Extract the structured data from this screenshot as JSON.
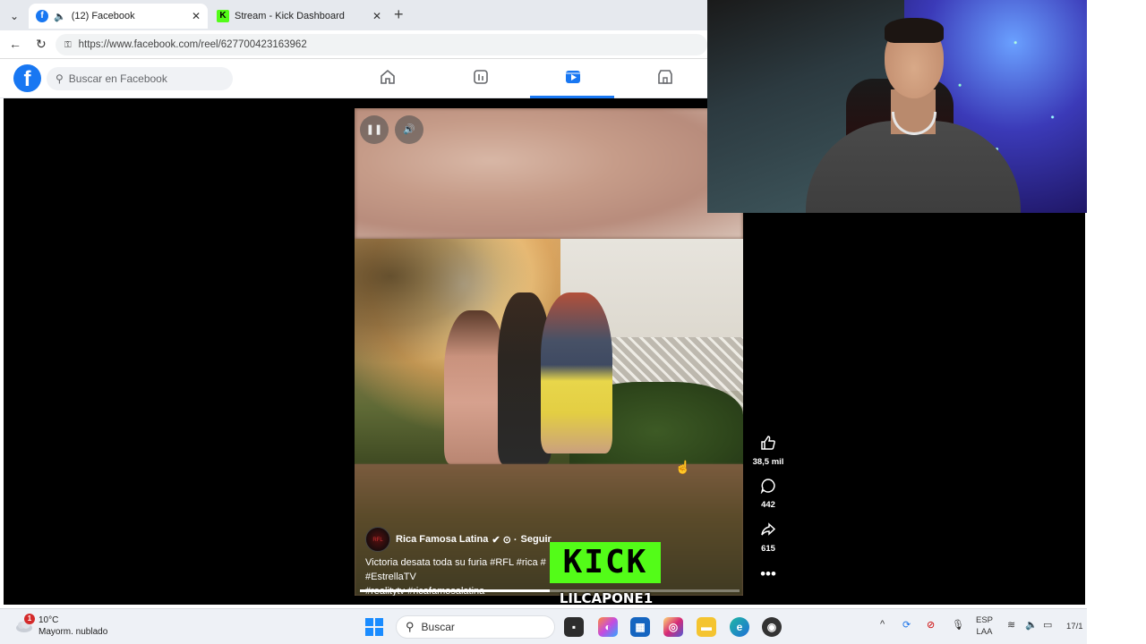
{
  "browser": {
    "tabs": [
      {
        "label": "(12) Facebook",
        "active": true
      },
      {
        "label": "Stream - Kick Dashboard",
        "active": false
      }
    ],
    "url": "https://www.facebook.com/reel/627700423163962"
  },
  "facebook": {
    "search_placeholder": "Buscar en Facebook",
    "logo_letter": "f"
  },
  "reel": {
    "author": "Rica Famosa Latina",
    "author_marks": "✔ ⊙ ·",
    "follow_label": "Seguir",
    "caption_line1": "Victoria desata toda su furia #RFL #rica #",
    "caption_line1_end": "#EstrellaTV",
    "caption_line2": "#realitytv #ricafamosalatina",
    "progress": 0.5,
    "likes": "38,5 mil",
    "comments": "442",
    "shares": "615"
  },
  "overlay": {
    "kick_logo": "KICK",
    "kick_user": "LILCAPONE1"
  },
  "taskbar": {
    "weather_badge": "1",
    "temperature": "10°C",
    "weather_desc": "Mayorm. nublado",
    "search_label": "Buscar",
    "lang_line1": "ESP",
    "lang_line2": "LAA",
    "clock": "17/1"
  },
  "colors": {
    "facebook_blue": "#1877f2",
    "kick_green": "#53fc18"
  }
}
